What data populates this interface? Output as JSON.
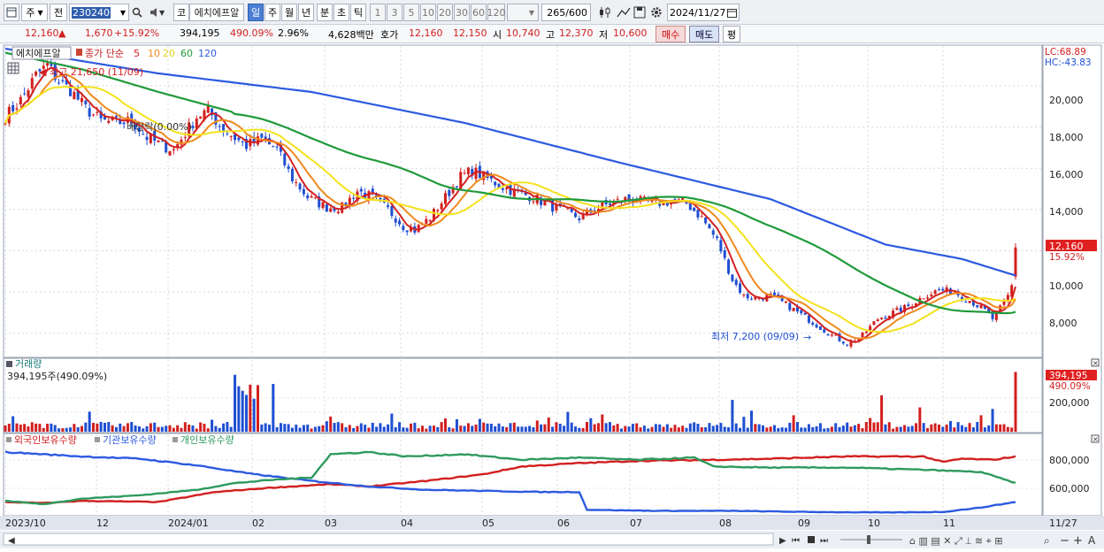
{
  "toolbar": {
    "type_label": "주",
    "prev_label": "전",
    "code_value": "230240",
    "ko_label": "코",
    "stock_name": "에치에프알",
    "periods": [
      "일",
      "주",
      "월",
      "년",
      "분",
      "초",
      "틱"
    ],
    "minutes": [
      "1",
      "3",
      "5",
      "10",
      "20",
      "30",
      "60",
      "120"
    ],
    "count_value": "265",
    "count_total": "/600",
    "date_value": "2024/11/27"
  },
  "quote": {
    "price": "12,160",
    "arrow": "▲",
    "change": "1,670",
    "change_pct": "+15.92%",
    "volume": "394,195",
    "volume_pct": "490.09%",
    "turnover": "2.96%",
    "amount": "4,628백만",
    "bid_label": "호가",
    "ask_price": "12,160",
    "bid_price": "12,150",
    "open_label": "시",
    "open": "10,740",
    "high_label": "고",
    "high": "12,370",
    "low_label": "저",
    "low": "10,600",
    "buy_label": "매수",
    "sell_label": "매도",
    "eval_label": "평"
  },
  "price_panel": {
    "name_tag": "에치에프알",
    "ma_title": "종가 단순",
    "ma_periods": [
      "5",
      "10",
      "20",
      "60",
      "120"
    ],
    "lc_label": "LC:68.89",
    "hc_label": "HC:-43.83",
    "high_marker": "최고 21,650 (11/09)",
    "low_marker": "최저 7,200 (09/09)",
    "rights_marker": "배당락(0.00%)",
    "current_price_tag": "12,160",
    "current_pct_tag": "15.92%",
    "y_ticks": [
      "20,000",
      "18,000",
      "16,000",
      "14,000",
      "12,000",
      "10,000",
      "8,000"
    ]
  },
  "volume_panel": {
    "title": "거래량",
    "subtitle": "394,195주(490.09%)",
    "tag_value": "394,195",
    "tag_pct": "490.09%",
    "y_ticks": [
      "200,000"
    ]
  },
  "holdings_panel": {
    "legend": [
      "외국인보유수량",
      "기관보유수량",
      "개인보유수량"
    ],
    "y_ticks": [
      "800,000",
      "600,000"
    ]
  },
  "x_axis": {
    "labels": [
      "2023/10",
      "12",
      "2024/01",
      "02",
      "03",
      "04",
      "05",
      "06",
      "07",
      "08",
      "09",
      "10",
      "11"
    ],
    "right_label": "11/27"
  },
  "colors": {
    "ma5": "#d42020",
    "ma10": "#f08a1c",
    "ma20": "#f4e21c",
    "ma60": "#1f9a3a",
    "ma120": "#2c5ae0",
    "up": "#d21f1f",
    "down": "#1f4fd2",
    "foreign": "#d21f1f",
    "institution": "#2c5ae0",
    "individual": "#2f9a5f"
  },
  "chart_data": [
    {
      "type": "line",
      "title": "에치에프알 일봉",
      "x": [
        "2023/10",
        "2023/11",
        "2023/12",
        "2024/01",
        "2024/02",
        "2024/03",
        "2024/04",
        "2024/05",
        "2024/06",
        "2024/07",
        "2024/08",
        "2024/09",
        "2024/10",
        "2024/11",
        "2024/11/27"
      ],
      "series": [
        {
          "name": "종가",
          "values": [
            18500,
            21000,
            18200,
            17000,
            18200,
            15000,
            13800,
            13000,
            15800,
            14000,
            14500,
            9500,
            7500,
            9700,
            12160
          ]
        },
        {
          "name": "120",
          "values": [
            21800,
            21000,
            20200,
            19800,
            19100,
            18200,
            17400,
            16800,
            16100,
            15300,
            14500,
            13000,
            11800,
            11200,
            10800
          ]
        }
      ],
      "ylim": [
        7000,
        21800
      ]
    },
    {
      "type": "bar",
      "title": "거래량",
      "series": [
        {
          "name": "거래량",
          "values": [
            394195
          ]
        }
      ]
    },
    {
      "type": "line",
      "series": [
        {
          "name": "외국인보유수량",
          "values": [
            470000,
            480000,
            560000,
            620000,
            600000,
            620000,
            680000,
            800000,
            840000,
            850000,
            870000,
            900000,
            880000,
            860000
          ]
        },
        {
          "name": "기관보유수량",
          "values": [
            920000,
            880000,
            800000,
            700000,
            620000,
            600000,
            560000,
            550000,
            520000,
            400000,
            380000,
            370000,
            380000,
            460000
          ]
        },
        {
          "name": "개인보유수량",
          "values": [
            480000,
            500000,
            560000,
            680000,
            900000,
            920000,
            880000,
            850000,
            860000,
            790000,
            780000,
            770000,
            750000,
            640000
          ]
        }
      ]
    }
  ]
}
